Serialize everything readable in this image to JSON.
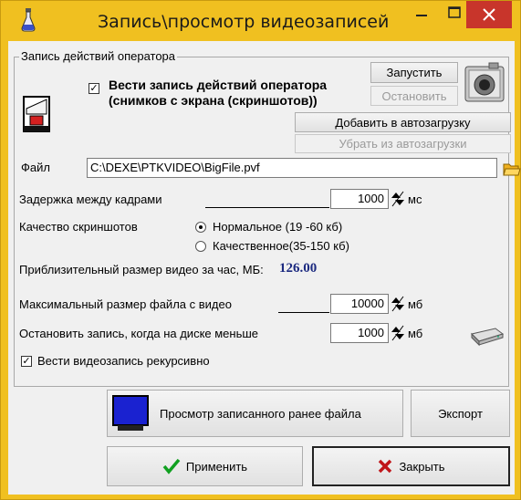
{
  "window": {
    "title": "Запись\\просмотр видеозаписей",
    "accent": "#f0c020",
    "close_color": "#c8352b"
  },
  "operator_group": {
    "title": "Запись действий оператора",
    "record_checkbox_checked": true,
    "record_label_line1": "Вести запись действий оператора",
    "record_label_line2": "(снимков с экрана (скриншотов))",
    "start_label": "Запустить",
    "stop_label": "Остановить",
    "autostart_add_label": "Добавить в автозагрузку",
    "autostart_remove_label": "Убрать из автозагрузки"
  },
  "file": {
    "label": "Файл",
    "value": "C:\\DEXE\\PTKVIDEO\\BigFile.pvf"
  },
  "delay": {
    "label": "Задержка между кадрами",
    "value": "1000",
    "unit": "мс"
  },
  "quality": {
    "label": "Качество скриншотов",
    "option_normal": "Нормальное (19 -60 кб)",
    "option_high": "Качественное(35-150 кб)",
    "selected": "normal"
  },
  "approx_size": {
    "label": "Приблизительный размер видео за час, МБ:",
    "value": "126.00"
  },
  "max_size": {
    "label": "Максимальный размер файла с видео",
    "value": "10000",
    "unit": "мб"
  },
  "disk_stop": {
    "label": "Остановить запись, когда на диске меньше",
    "value": "1000",
    "unit": "мб"
  },
  "recursive": {
    "label": "Вести видеозапись рекурсивно",
    "checked": true
  },
  "buttons": {
    "view_label": "Просмотр записанного ранее файла",
    "export_label": "Экспорт",
    "apply_label": "Применить",
    "close_label": "Закрыть"
  },
  "icons": {
    "app": "flask-icon",
    "switch": "switch-icon",
    "camera": "camera-icon",
    "folder": "folder-icon",
    "drive": "drive-icon",
    "monitor": "monitor-icon",
    "apply": "checkmark-icon",
    "close": "x-icon"
  }
}
